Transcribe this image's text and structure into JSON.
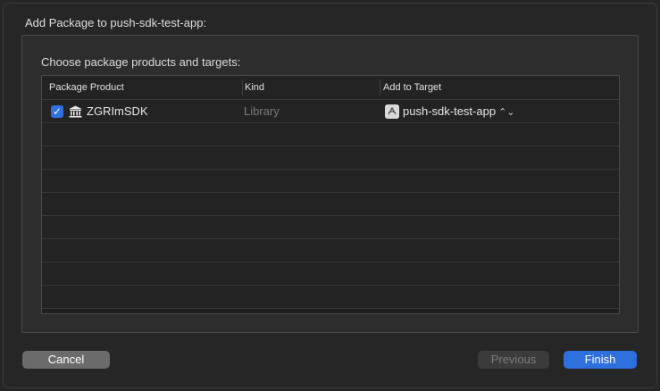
{
  "dialog": {
    "title": "Add Package to push-sdk-test-app:",
    "subtitle": "Choose package products and targets:"
  },
  "table": {
    "headers": [
      "Package Product",
      "Kind",
      "Add to Target"
    ],
    "rows": [
      {
        "checked": true,
        "product": "ZGRImSDK",
        "kind": "Library",
        "target": "push-sdk-test-app",
        "product_icon": "package-icon",
        "target_icon": "app-target-icon"
      }
    ],
    "empty_rows": 8
  },
  "buttons": {
    "cancel": "Cancel",
    "previous": "Previous",
    "finish": "Finish"
  },
  "colors": {
    "accent": "#2e6fde",
    "background": "#262626",
    "panel": "#2d2d2d"
  }
}
